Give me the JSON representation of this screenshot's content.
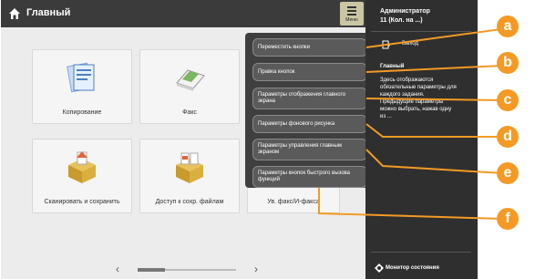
{
  "header": {
    "title": "Главный",
    "menu_label": "Меню"
  },
  "tiles": [
    {
      "label": "Копирование",
      "icon": "copy-icon"
    },
    {
      "label": "Факс",
      "icon": "fax-icon"
    },
    {
      "label": "Сканировать и сохранить",
      "icon": "scan-save-icon"
    },
    {
      "label": "Доступ к сохр. файлам",
      "icon": "stored-files-icon"
    },
    {
      "label": "Ув. факс/И-факса",
      "icon": "fax-inbox-icon"
    }
  ],
  "menu": {
    "items": [
      "Переместить кнопки",
      "Правка кнопок",
      "Параметры отображения главного экрана",
      "Параметры фонового рисунка",
      "Параметры управления главным экраном",
      "Параметры кнопок быстрого вызова функций"
    ]
  },
  "right_panel": {
    "admin_name": "Администратор",
    "admin_id": "11 (Кол. на ...)",
    "logout": "Выход",
    "section": "Главный",
    "description": "Здесь отображаются обязательные параметры для каждого задания. Предыдущие параметры можно выбрать, нажав одну из ..."
  },
  "footer": {
    "status_label": "Монитор состояния"
  },
  "callouts": [
    "a",
    "b",
    "c",
    "d",
    "e",
    "f"
  ],
  "colors": {
    "callout": "#f49a24",
    "panel": "#3f3f3f",
    "topbar": "#3b3b3b"
  }
}
